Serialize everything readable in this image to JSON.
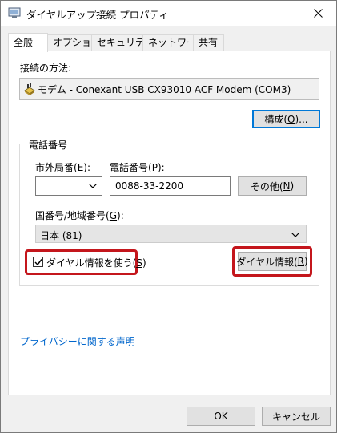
{
  "window": {
    "title": "ダイヤルアップ接続 プロパティ"
  },
  "tabs": [
    {
      "label": "全般",
      "active": true
    },
    {
      "label": "オプション",
      "active": false
    },
    {
      "label": "セキュリティ",
      "active": false
    },
    {
      "label": "ネットワーク",
      "active": false
    },
    {
      "label": "共有",
      "active": false
    }
  ],
  "general": {
    "connect_using_label": "接続の方法:",
    "device_name": "モデム - Conexant USB CX93010 ACF Modem (COM3)",
    "configure_button": {
      "text": "構成(",
      "accel": "O",
      "suffix": ")..."
    },
    "phone_group_title": "電話番号",
    "area_code_label": {
      "text": "市外局番(",
      "accel": "E",
      "suffix": "):"
    },
    "area_code_value": "",
    "phone_number_label": {
      "text": "電話番号(",
      "accel": "P",
      "suffix": "):"
    },
    "phone_number_value": "0088-33-2200",
    "alternates_button": {
      "text": "その他(",
      "accel": "N",
      "suffix": ")"
    },
    "country_label": {
      "text": "国番号/地域番号(",
      "accel": "G",
      "suffix": "):"
    },
    "country_value": "日本 (81)",
    "use_dialing_rules": {
      "text": "ダイヤル情報を使う(",
      "accel": "S",
      "suffix": ")",
      "checked": true
    },
    "dialing_rules_button": {
      "text": "ダイヤル情報(",
      "accel": "R",
      "suffix": ")"
    },
    "privacy_link": "プライバシーに関する声明"
  },
  "footer": {
    "ok_label": "OK",
    "cancel_label": "キャンセル"
  },
  "colors": {
    "highlight": "#c4161c",
    "focus": "#0078d7",
    "link": "#0066cc"
  }
}
